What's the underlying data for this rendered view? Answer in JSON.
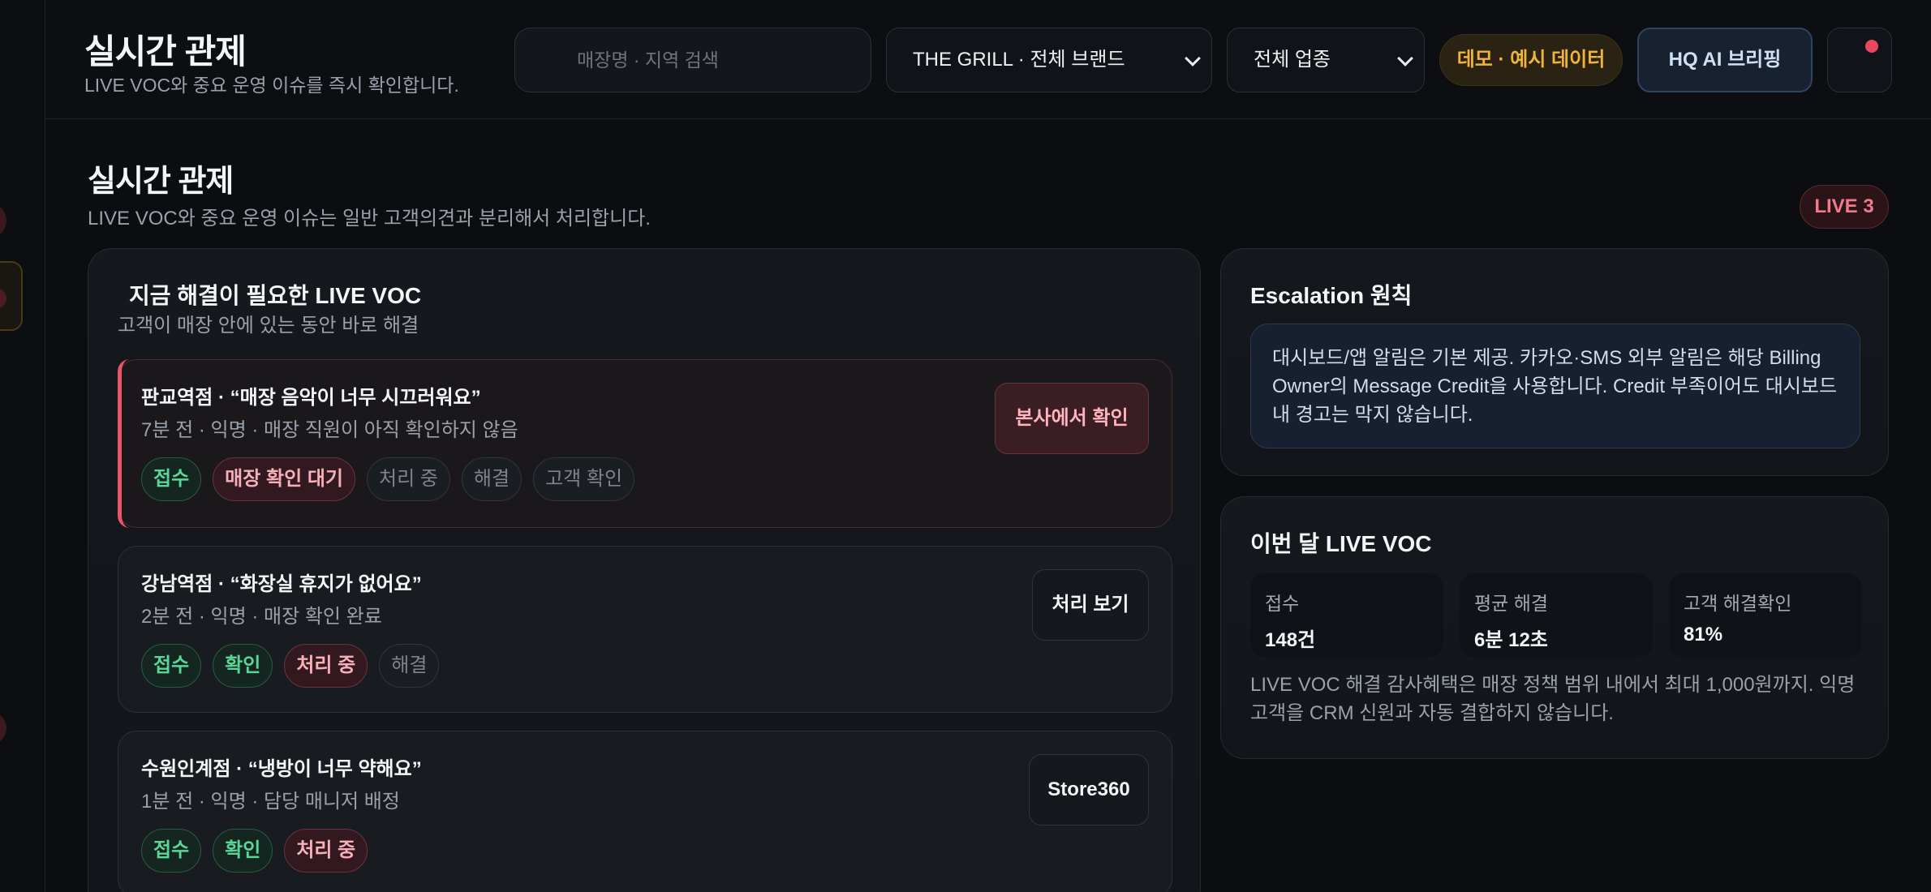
{
  "header": {
    "title": "실시간 관제",
    "subtitle": "LIVE VOC와 중요 운영 이슈를 즉시 확인합니다.",
    "search_placeholder": "매장명 · 지역 검색",
    "brand_select": "THE GRILL · 전체 브랜드",
    "type_select": "전체 업종",
    "demo_label": "데모 · 예시 데이터",
    "ai_button": "HQ AI 브리핑"
  },
  "page": {
    "title": "실시간 관제",
    "subtitle": "LIVE VOC와 중요 운영 이슈는 일반 고객의견과 분리해서 처리합니다.",
    "live_badge": "LIVE 3"
  },
  "live_panel": {
    "title": "지금 해결이 필요한 LIVE VOC",
    "subtitle": "고객이 매장 안에 있는 동안 바로 해결",
    "items": [
      {
        "title": "판교역점 · “매장 음악이 너무 시끄러워요”",
        "meta": "7분 전 · 익명 · 매장 직원이 아직 확인하지 않음",
        "action": "본사에서 확인",
        "chips": [
          "접수",
          "매장 확인 대기",
          "처리 중",
          "해결",
          "고객 확인"
        ]
      },
      {
        "title": "강남역점 · “화장실 휴지가 없어요”",
        "meta": "2분 전 · 익명 · 매장 확인 완료",
        "action": "처리 보기",
        "chips": [
          "접수",
          "확인",
          "처리 중",
          "해결"
        ]
      },
      {
        "title": "수원인계점 · “냉방이 너무 약해요”",
        "meta": "1분 전 · 익명 · 담당 매니저 배정",
        "action": "Store360",
        "chips": [
          "접수",
          "확인",
          "처리 중"
        ]
      }
    ]
  },
  "rule_panel": {
    "title": "Escalation 원칙",
    "body": "대시보드/앱 알림은 기본 제공. 카카오·SMS 외부 알림은 해당 Billing Owner의 Message Credit을 사용합니다. Credit 부족이어도 대시보드 내 경고는 막지 않습니다."
  },
  "stats_panel": {
    "title": "이번 달 LIVE VOC",
    "stats": [
      {
        "label": "접수",
        "value": "148건"
      },
      {
        "label": "평균 해결",
        "value": "6분 12초"
      },
      {
        "label": "고객 해결확인",
        "value": "81%"
      }
    ],
    "note": "LIVE VOC 해결 감사혜택은 매장 정책 범위 내에서 최대 1,000원까지. 익명 고객을 CRM 신원과 자동 결합하지 않습니다."
  },
  "colors": {
    "accent_red": "#e8566a",
    "done_green": "#59d69a",
    "demo_amber": "#f0b43c"
  }
}
